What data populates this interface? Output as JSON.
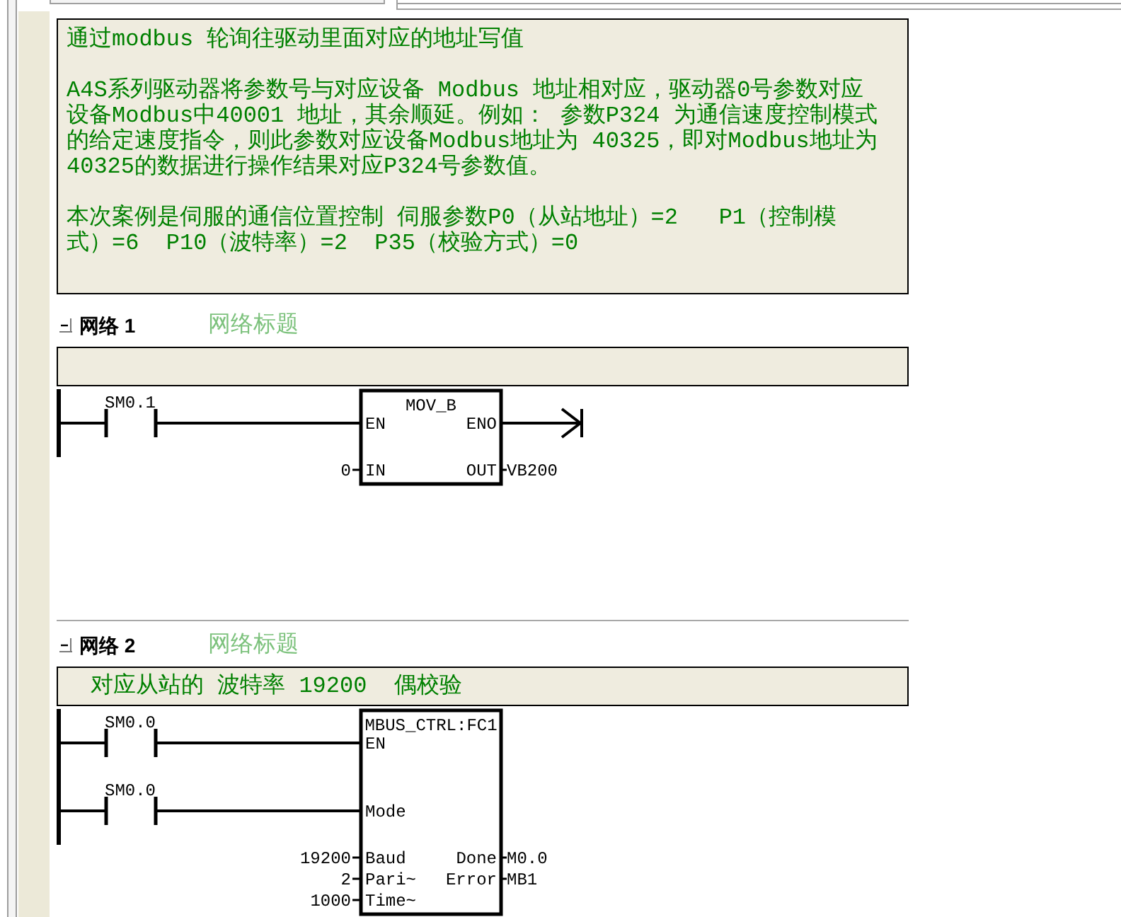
{
  "program_comment": {
    "paragraphs": [
      [
        "通过modbus 轮询往驱动里面对应的地址写值"
      ],
      [
        "A4S系列驱动器将参数号与对应设备 Modbus 地址相对应，驱动器0号参数对应",
        "设备Modbus中40001 地址，其余顺延。例如： 参数P324 为通信速度控制模式",
        "的给定速度指令，则此参数对应设备Modbus地址为 40325，即对Modbus地址为",
        "40325的数据进行操作结果对应P324号参数值。"
      ],
      [
        "本次案例是伺服的通信位置控制 伺服参数P0（从站地址）=2   P1（控制模",
        "式）=6  P10（波特率）=2  P35（校验方式）=0"
      ]
    ]
  },
  "networks": [
    {
      "label": "网络 1",
      "title": "网络标题",
      "expanded": true,
      "rung": {
        "block": "MOV_B",
        "rows": [
          {
            "left": {
              "kind": "contact",
              "pin": "EN",
              "address": "SM0.1"
            },
            "right": {
              "kind": "open_end",
              "pin": "ENO"
            }
          },
          {
            "left": {
              "kind": "operand",
              "pin": "IN",
              "value": "0"
            },
            "right": {
              "kind": "operand",
              "pin": "OUT",
              "value": "VB200"
            }
          }
        ]
      }
    },
    {
      "label": "网络 2",
      "title": "网络标题",
      "expanded": true,
      "comment": "对应从站的 波特率 19200  偶校验",
      "rung": {
        "block": "MBUS_CTRL:FC1",
        "rows": [
          {
            "left": {
              "kind": "contact",
              "pin": "EN",
              "address": "SM0.0"
            }
          },
          {
            "left": {
              "kind": "contact",
              "pin": "Mode",
              "address": "SM0.0"
            }
          },
          {
            "left": {
              "kind": "operand",
              "pin": "Baud",
              "value": "19200"
            },
            "right": {
              "kind": "operand",
              "pin": "Done",
              "value": "M0.0"
            }
          },
          {
            "left": {
              "kind": "operand",
              "pin": "Pari~",
              "value": "2"
            },
            "right": {
              "kind": "operand",
              "pin": "Error",
              "value": "MB1"
            }
          },
          {
            "left": {
              "kind": "operand",
              "pin": "Time~",
              "value": "1000"
            }
          }
        ]
      }
    }
  ]
}
